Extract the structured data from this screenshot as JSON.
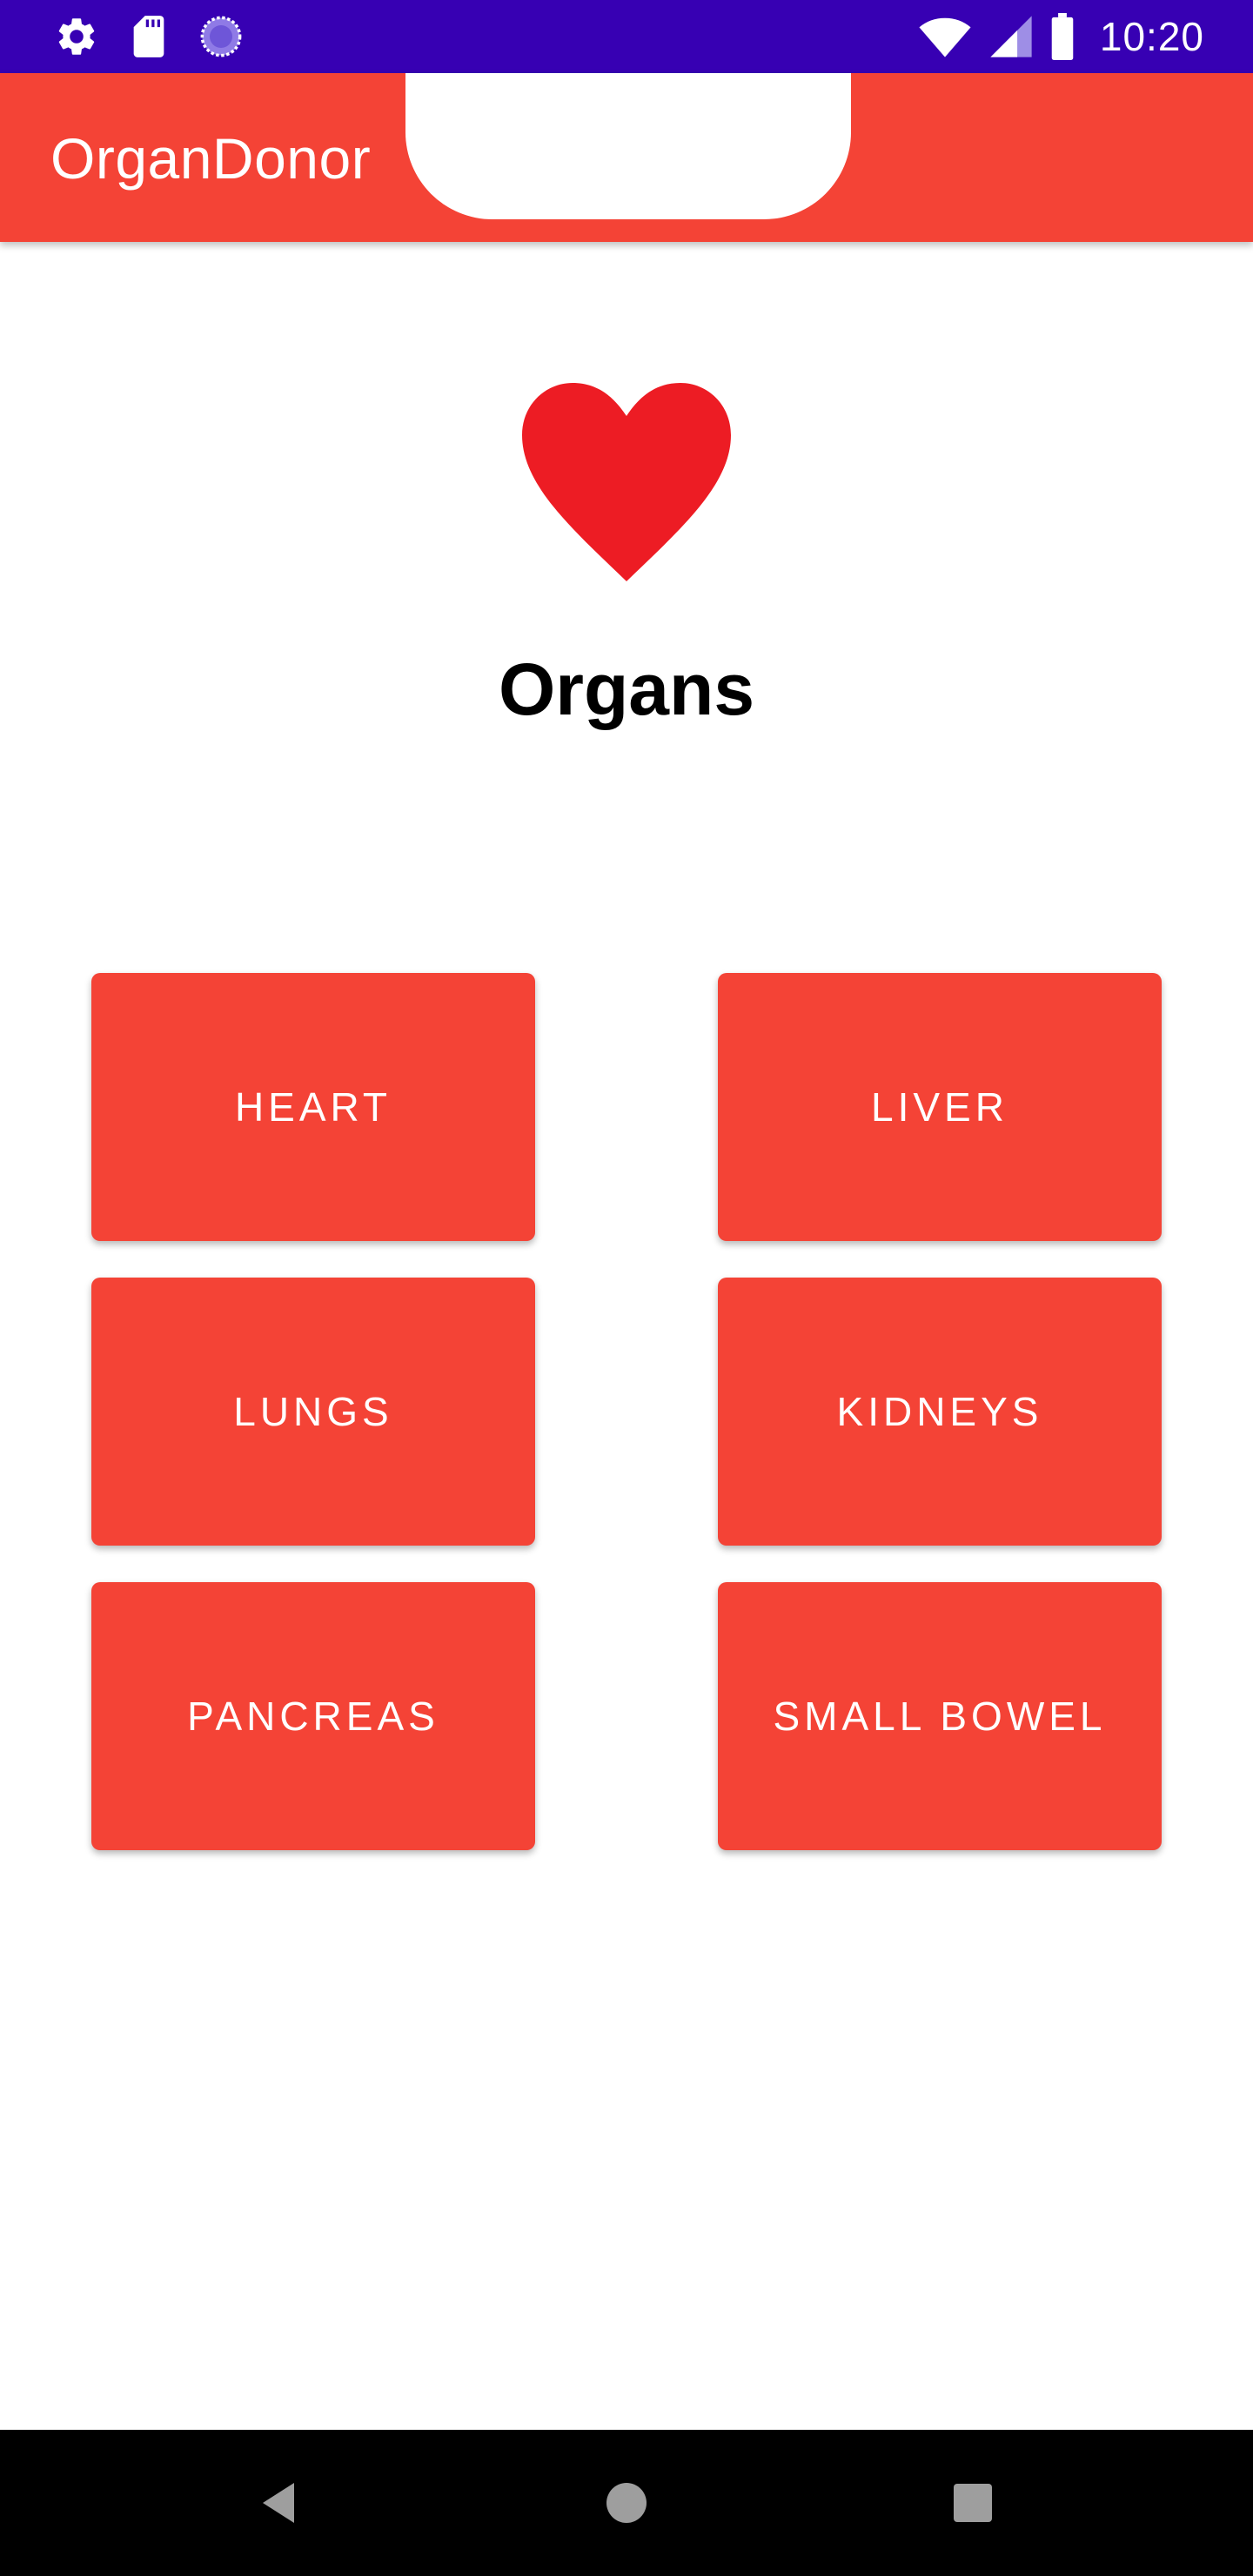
{
  "status_bar": {
    "time": "10:20",
    "left_icons": [
      "settings-icon",
      "sd-card-icon",
      "sync-icon"
    ],
    "right_icons": [
      "wifi-icon",
      "signal-icon",
      "battery-icon"
    ],
    "background_color": "#3700b3"
  },
  "app_bar": {
    "title": "OrganDonor",
    "background_color": "#f44336"
  },
  "hero": {
    "icon": "heart-icon",
    "icon_color": "#ed1c24",
    "title": "Organs"
  },
  "organs": [
    {
      "label": "HEART"
    },
    {
      "label": "LIVER"
    },
    {
      "label": "LUNGS"
    },
    {
      "label": "KIDNEYS"
    },
    {
      "label": "PANCREAS"
    },
    {
      "label": "SMALL BOWEL"
    }
  ],
  "button_color": "#f44336",
  "nav_bar": {
    "buttons": [
      "back-icon",
      "home-icon",
      "recent-apps-icon"
    ]
  }
}
